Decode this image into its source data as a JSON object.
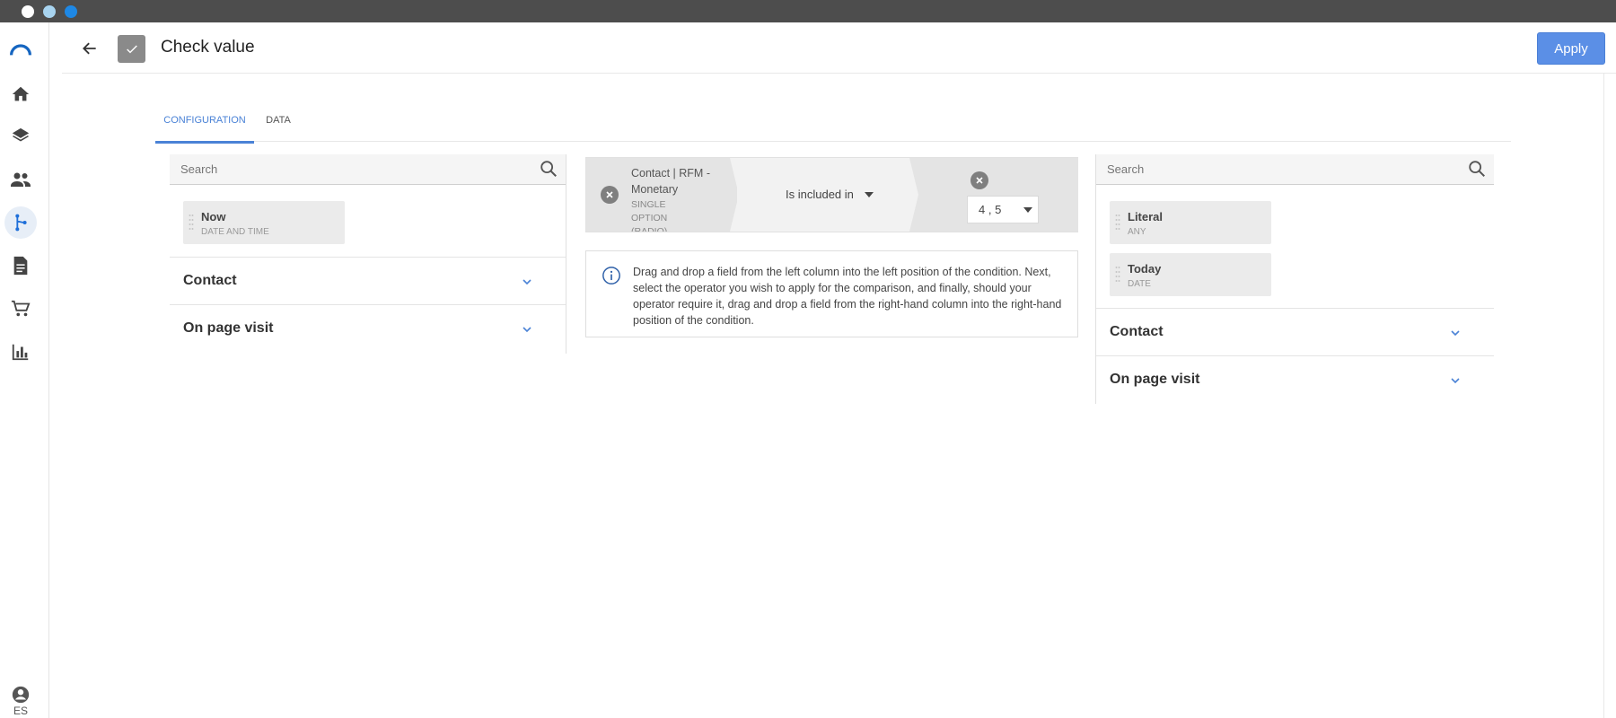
{
  "window": {
    "dot_colors": [
      "#ffffff",
      "#a8d4f0",
      "#1e88e5"
    ]
  },
  "sidebar": {
    "items": [
      {
        "icon": "logo-icon"
      },
      {
        "icon": "home-icon"
      },
      {
        "icon": "layers-icon"
      },
      {
        "icon": "people-icon"
      },
      {
        "icon": "workflow-icon",
        "active": true
      },
      {
        "icon": "document-icon"
      },
      {
        "icon": "cart-icon"
      },
      {
        "icon": "bar-chart-icon"
      }
    ],
    "user_icon": "account-icon",
    "language": "ES"
  },
  "header": {
    "title": "Check value",
    "apply_label": "Apply"
  },
  "tabs": [
    {
      "label": "CONFIGURATION",
      "active": true
    },
    {
      "label": "DATA",
      "active": false
    }
  ],
  "left_panel": {
    "search_placeholder": "Search",
    "fields": [
      {
        "name": "Now",
        "type": "DATE AND TIME"
      }
    ],
    "groups": [
      {
        "label": "Contact"
      },
      {
        "label": "On page visit"
      }
    ]
  },
  "condition": {
    "left_field": "Contact | RFM - Monetary",
    "left_field_type": "SINGLE OPTION (RADIO)",
    "operator": "Is included in",
    "value": "4 , 5"
  },
  "info": {
    "text": "Drag and drop a field from the left column into the left position of the condition. Next, select the operator you wish to apply for the comparison, and finally, should your operator require it, drag and drop a field from the right-hand column into the right-hand position of the condition."
  },
  "right_panel": {
    "search_placeholder": "Search",
    "fields": [
      {
        "name": "Literal",
        "type": "ANY"
      },
      {
        "name": "Today",
        "type": "DATE"
      }
    ],
    "groups": [
      {
        "label": "Contact"
      },
      {
        "label": "On page visit"
      }
    ]
  },
  "colors": {
    "accent": "#4a82d6",
    "apply_button": "#5b8fe6",
    "titlebar": "#4d4d4d"
  }
}
